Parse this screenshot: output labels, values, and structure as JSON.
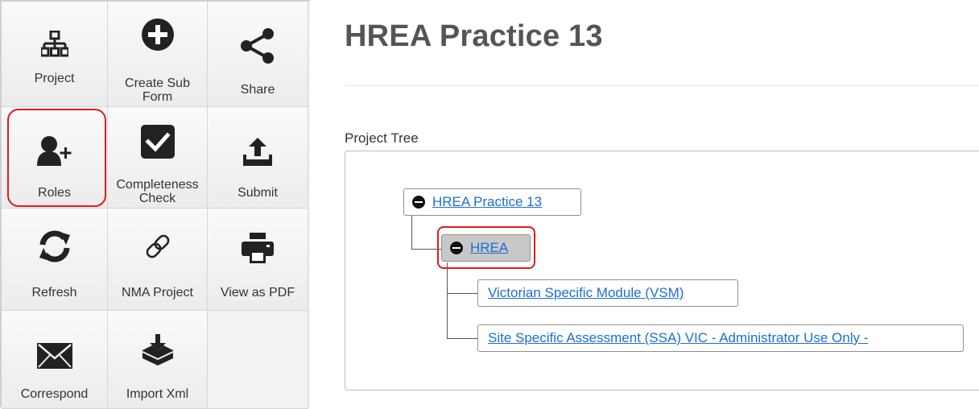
{
  "toolbar": {
    "project": "Project",
    "create_sub_form": "Create Sub\nForm",
    "share": "Share",
    "roles": "Roles",
    "completeness_check": "Completeness\nCheck",
    "submit": "Submit",
    "refresh": "Refresh",
    "nma_project": "NMA Project",
    "view_as_pdf": "View as PDF",
    "correspond": "Correspond",
    "import_xml": "Import Xml"
  },
  "icons": {
    "project": "sitemap-icon",
    "create_sub_form": "plus-circle-icon",
    "share": "share-icon",
    "roles": "user-plus-icon",
    "completeness_check": "check-square-icon",
    "submit": "upload-icon",
    "refresh": "refresh-icon",
    "nma_project": "link-icon",
    "view_as_pdf": "print-icon",
    "correspond": "envelope-icon",
    "import_xml": "import-icon"
  },
  "main": {
    "title": "HREA Practice 13",
    "section_label": "Project Tree"
  },
  "tree": {
    "root": "HREA Practice 13",
    "child": "HREA",
    "leaf1": "Victorian Specific Module (VSM)",
    "leaf2": "Site Specific Assessment (SSA) VIC - Administrator Use Only -"
  },
  "colors": {
    "highlight": "#e21b1b",
    "link": "#1b6fd0",
    "icon": "#222222",
    "selected_node": "#c8c8c8"
  }
}
